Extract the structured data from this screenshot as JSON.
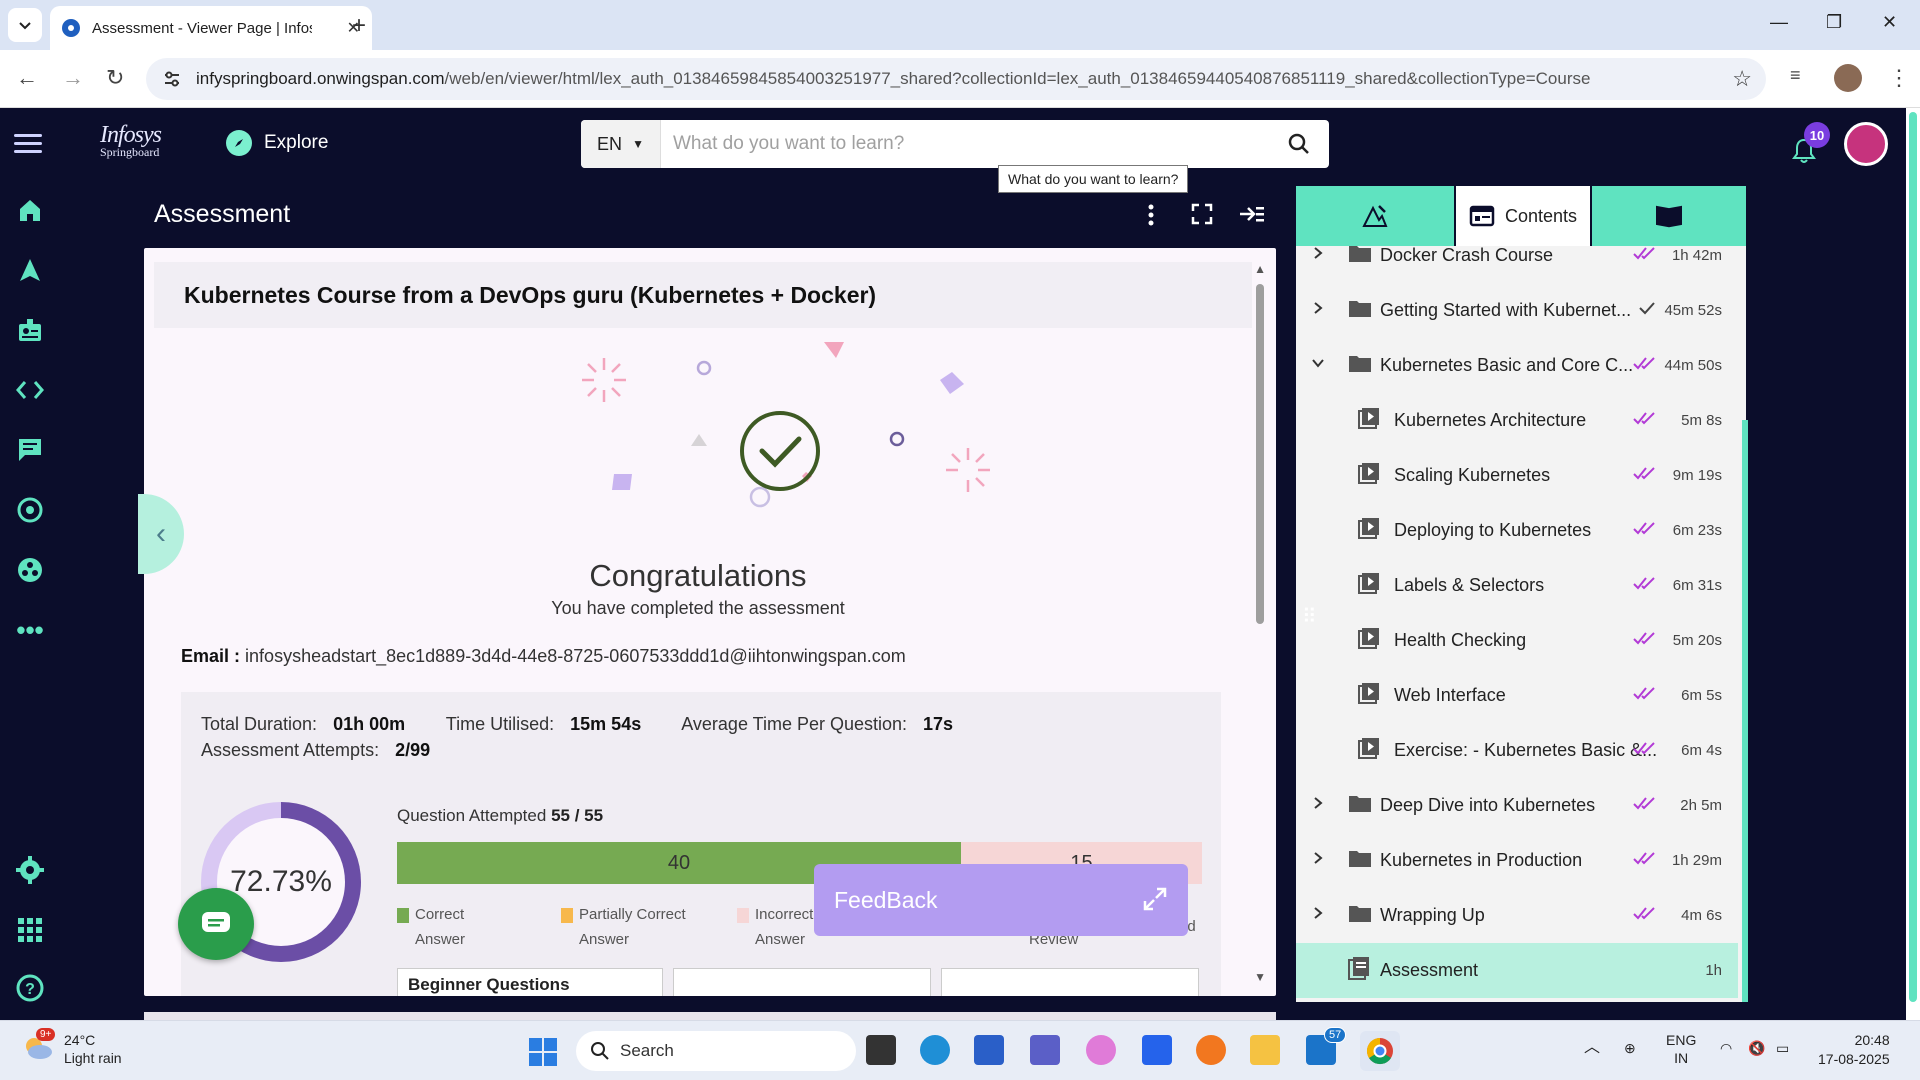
{
  "browser": {
    "tab_title": "Assessment - Viewer Page | Infosys Springboard",
    "url_host": "infyspringboard.onwingspan.com",
    "url_path": "/web/en/viewer/html/lex_auth_01384659845854003251977_shared?collectionId=lex_auth_01384659440540876851119_shared&collectionType=Course"
  },
  "appnav": {
    "logo_line1": "Infosys",
    "logo_line2": "Springboard",
    "explore": "Explore",
    "lang": "EN",
    "search_placeholder": "What do you want to learn?",
    "tooltip": "What do you want to learn?",
    "notifications": "10"
  },
  "assessment": {
    "header": "Assessment",
    "course_title": "Kubernetes Course from a DevOps guru (Kubernetes + Docker)",
    "congrats": "Congratulations",
    "congrats_sub": "You have completed the assessment",
    "email_label": "Email :",
    "email": "infosysheadstart_8ec1d889-3d4d-44e8-8725-0607533ddd1d@iihtonwingspan.com",
    "total_duration_label": "Total Duration:",
    "total_duration": "01h 00m",
    "time_utilised_label": "Time Utilised:",
    "time_utilised": "15m 54s",
    "avg_time_label": "Average Time Per Question:",
    "avg_time": "17s",
    "attempts_label": "Assessment Attempts:",
    "attempts": "2/99",
    "score_percent": "72.73%",
    "score_fraction": 0.7273,
    "qa_label": "Question Attempted",
    "qa_value": "55 / 55",
    "correct": "40",
    "incorrect": "15",
    "correct_count": 40,
    "incorrect_count": 15,
    "legend": {
      "correct_1": "Correct",
      "correct_2": "Answer",
      "partial_1": "Partially Correct",
      "partial_2": "Answer",
      "incorrect_1": "Incorrect",
      "incorrect_2": "Answer",
      "review": "Review",
      "unread": "ad"
    },
    "q_tabs": [
      "Beginner Questions",
      "",
      ""
    ],
    "feedback": "FeedBack"
  },
  "contents": {
    "tab_label": "Contents",
    "items": [
      {
        "kind": "folder",
        "title": "Docker Crash Course",
        "dur": "1h 42m",
        "ticks": "double"
      },
      {
        "kind": "folder",
        "title": "Getting Started with Kubernet...",
        "dur": "45m 52s",
        "ticks": "single"
      },
      {
        "kind": "folder-open",
        "title": "Kubernetes Basic and Core C...",
        "dur": "44m 50s",
        "ticks": "double"
      },
      {
        "kind": "video",
        "title": "Kubernetes Architecture",
        "dur": "5m 8s",
        "ticks": "double"
      },
      {
        "kind": "video",
        "title": "Scaling Kubernetes",
        "dur": "9m 19s",
        "ticks": "double"
      },
      {
        "kind": "video",
        "title": "Deploying to Kubernetes",
        "dur": "6m 23s",
        "ticks": "double"
      },
      {
        "kind": "video",
        "title": "Labels & Selectors",
        "dur": "6m 31s",
        "ticks": "double"
      },
      {
        "kind": "video",
        "title": "Health Checking",
        "dur": "5m 20s",
        "ticks": "double"
      },
      {
        "kind": "video",
        "title": "Web Interface",
        "dur": "6m 5s",
        "ticks": "double"
      },
      {
        "kind": "video",
        "title": "Exercise: - Kubernetes Basic &...",
        "dur": "6m 4s",
        "ticks": "double"
      },
      {
        "kind": "folder",
        "title": "Deep Dive into Kubernetes",
        "dur": "2h 5m",
        "ticks": "double"
      },
      {
        "kind": "folder",
        "title": "Kubernetes in Production",
        "dur": "1h 29m",
        "ticks": "double"
      },
      {
        "kind": "folder",
        "title": "Wrapping Up",
        "dur": "4m 6s",
        "ticks": "double"
      },
      {
        "kind": "doc",
        "title": "Assessment",
        "dur": "1h",
        "ticks": "none"
      }
    ]
  },
  "taskbar": {
    "weather_badge": "9+",
    "temp": "24°C",
    "weather": "Light rain",
    "search": "Search",
    "outlook_badge": "57",
    "lang1": "ENG",
    "lang2": "IN",
    "time": "20:48",
    "date": "17-08-2025"
  },
  "colors": {
    "app_bg": "#0b0d2b",
    "accent_mint": "#5fe3c0",
    "correct_green": "#76aa52",
    "incorrect_pink": "#f6d6d6",
    "donut_purple": "#6b4ea6",
    "feedback_purple": "#b39cf1",
    "tick_purple": "#b23ad6"
  }
}
